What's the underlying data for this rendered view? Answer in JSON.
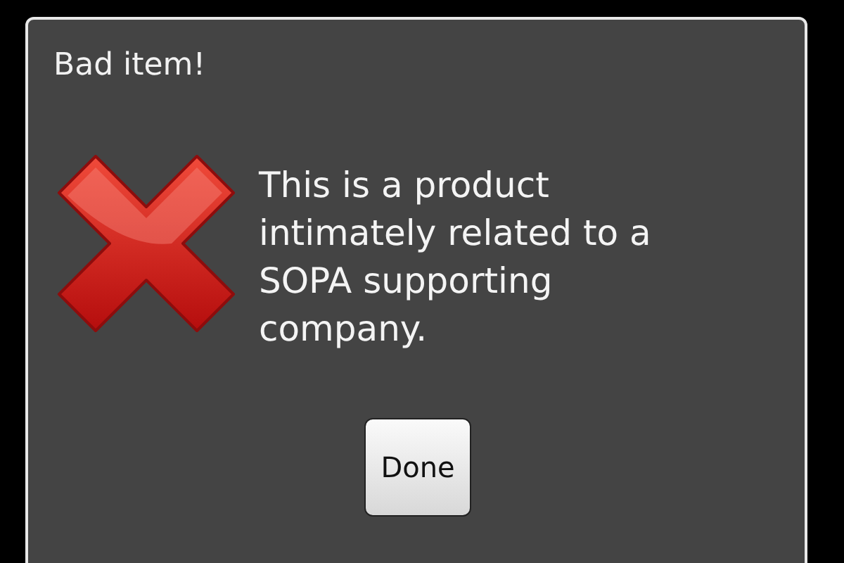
{
  "dialog": {
    "title": "Bad item!",
    "message": "This is a product intimately related to a SOPA supporting company.",
    "buttons": [
      "Done"
    ]
  }
}
